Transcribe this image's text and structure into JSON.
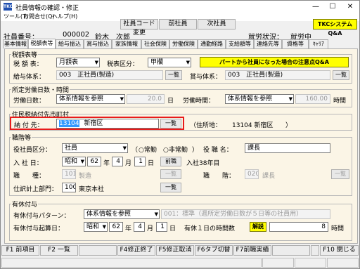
{
  "window": {
    "app_icon_text": "TKC",
    "title": "社員情報の確認・修正",
    "minimize": "—",
    "maximize": "☐",
    "close": "✕"
  },
  "menu": [
    "ツール(T)",
    "お問合せ(Q)",
    "ヘルプ(H)"
  ],
  "toolbar": {
    "code_change": "社員コード変更",
    "prev_employee": "前社員",
    "next_employee": "次社員",
    "tkc_qa": "TKCシステムQ&A"
  },
  "employee": {
    "number_label": "社員番号：",
    "number": "000002",
    "name": "鈴木　次郎",
    "status_label": "就労状況：",
    "status": "就労中"
  },
  "tabs": [
    "基本情報",
    "税額表等",
    "給与振込",
    "賞与振込",
    "家族情報",
    "社会保険",
    "労働保険",
    "通勤経路",
    "支給額等",
    "連絡先等",
    "資格等",
    "ｷｬﾘｱ"
  ],
  "tax_table": {
    "title": "税額表等",
    "tax_label": "税 額 表：",
    "tax_value": "月額表",
    "tax_class_label": "税表区分：",
    "tax_class_value": "甲欄",
    "notice_button": "パートから社員になった場合の注意点Q&A",
    "salary_system_label": "給与体系：",
    "salary_system_code": "003",
    "salary_system_name": "正社員(製造)",
    "list_button": "一覧",
    "bonus_system_label": "賞与体系：",
    "bonus_system_code": "003",
    "bonus_system_name": "正社員(製造)",
    "bonus_list_button": "一覧"
  },
  "work_days": {
    "title": "所定労働日数・時間",
    "days_label": "労働日数：",
    "days_select": "体系情報を参照",
    "days_value": "20.0",
    "days_unit": "日",
    "hours_label": "労働時間：",
    "hours_select": "体系情報を参照",
    "hours_value": "160.00",
    "hours_unit": "時間"
  },
  "residence_tax": {
    "title": "住民税納付先市町村",
    "payee_label": "納 付 先：",
    "payee_code": "13104",
    "payee_name": "新宿区",
    "list_button": "一覧",
    "address_label": "（住所地：",
    "address_value": "13104 新宿区",
    "address_close": "）"
  },
  "position": {
    "title": "職階等",
    "officer_label": "役社員区分：",
    "officer_value": "社員",
    "radio_open": "（",
    "radio_fulltime": "常勤",
    "radio_parttime": "非常勤",
    "radio_close": "）",
    "title_label": "役 職 名：",
    "title_value": "課長",
    "join_label": "入 社 日：",
    "era": "昭和",
    "year": "62",
    "year_unit": "年",
    "month": "4",
    "month_unit": "月",
    "day": "1",
    "day_unit": "日",
    "prev_era_button": "前職",
    "tenure": "入社38年目",
    "job_type_label": "職　　種：",
    "job_type_code": "101",
    "job_type_name": "製造",
    "job_list_button": "一覧",
    "grade_label": "職　　階：",
    "grade_code": "020",
    "grade_name": "課長",
    "grade_list_button": "一覧",
    "dept_label": "仕訳計上部門：",
    "dept_code": "100",
    "dept_name": "東京本社",
    "dept_list_button": "一覧"
  },
  "paid_leave": {
    "title": "有休付与",
    "pattern_label": "有休付与パターン：",
    "pattern_select": "体系情報を参照",
    "pattern_value": "001：標準（週所定労働日数が５日等の社員用）",
    "start_label": "有休付与起算日：",
    "era": "昭和",
    "year": "62",
    "year_unit": "年",
    "month": "4",
    "month_unit": "月",
    "day": "1",
    "day_unit": "日",
    "hours_label": "有休１日の時間数",
    "explain_button": "解説",
    "hours_value": "8",
    "hours_unit": "時間"
  },
  "fkeys": {
    "f1": "F1 前項目",
    "f2": "F2 一覧",
    "f4": "F4修正終了",
    "f5": "F5修正取消",
    "f6": "F6タブ切替",
    "f7": "F7前職実績",
    "f10": "F10 閉じる"
  }
}
